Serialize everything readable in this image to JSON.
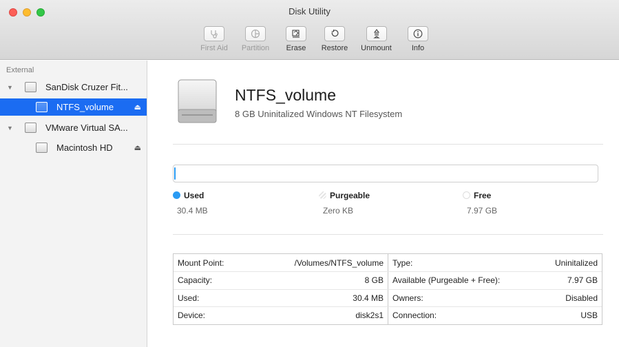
{
  "window": {
    "title": "Disk Utility"
  },
  "toolbar": {
    "first_aid": "First Aid",
    "partition": "Partition",
    "erase": "Erase",
    "restore": "Restore",
    "unmount": "Unmount",
    "info": "Info"
  },
  "sidebar": {
    "section": "External",
    "items": [
      {
        "label": "SanDisk Cruzer Fit...",
        "expanded": true,
        "selected": false
      },
      {
        "label": "NTFS_volume",
        "eject": "⏏",
        "selected": true
      },
      {
        "label": "VMware Virtual SA...",
        "expanded": true,
        "selected": false
      },
      {
        "label": "Macintosh HD",
        "eject": "⏏",
        "selected": false
      }
    ]
  },
  "volume": {
    "name": "NTFS_volume",
    "description": "8 GB Uninitalized Windows NT Filesystem"
  },
  "usage": {
    "used_fraction": 0.0038,
    "used": {
      "label": "Used",
      "value": "30.4 MB",
      "color": "#2a9bf3"
    },
    "purgeable": {
      "label": "Purgeable",
      "value": "Zero KB"
    },
    "free": {
      "label": "Free",
      "value": "7.97 GB"
    }
  },
  "info": {
    "mount_point": {
      "key": "Mount Point:",
      "value": "/Volumes/NTFS_volume"
    },
    "capacity": {
      "key": "Capacity:",
      "value": "8 GB"
    },
    "used": {
      "key": "Used:",
      "value": "30.4 MB"
    },
    "device": {
      "key": "Device:",
      "value": "disk2s1"
    },
    "type": {
      "key": "Type:",
      "value": "Uninitalized"
    },
    "available": {
      "key": "Available (Purgeable + Free):",
      "value": "7.97 GB"
    },
    "owners": {
      "key": "Owners:",
      "value": "Disabled"
    },
    "connection": {
      "key": "Connection:",
      "value": "USB"
    }
  }
}
